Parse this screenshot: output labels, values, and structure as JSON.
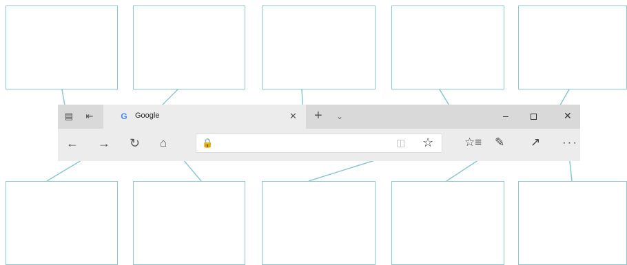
{
  "tab": {
    "title": "Google",
    "favicon": "G"
  },
  "colors": {
    "callout_border": "#8cc7d0",
    "tab_bar": "#d9d9d9",
    "toolbar": "#ececec"
  },
  "icons": {
    "set_aside": "tabs-aside-icon",
    "show_tabs": "show-aside-tabs-icon",
    "close_tab": "close-icon",
    "new_tab": "plus-icon",
    "tab_previews": "chevron-down-icon",
    "back": "arrow-left-icon",
    "forward": "arrow-right-icon",
    "refresh": "refresh-icon",
    "home": "home-icon",
    "lock": "lock-icon",
    "reading_view": "reading-view-icon",
    "favorite": "star-icon",
    "hub": "favorites-hub-icon",
    "web_note": "pen-icon",
    "share": "share-icon",
    "more": "ellipsis-icon"
  }
}
